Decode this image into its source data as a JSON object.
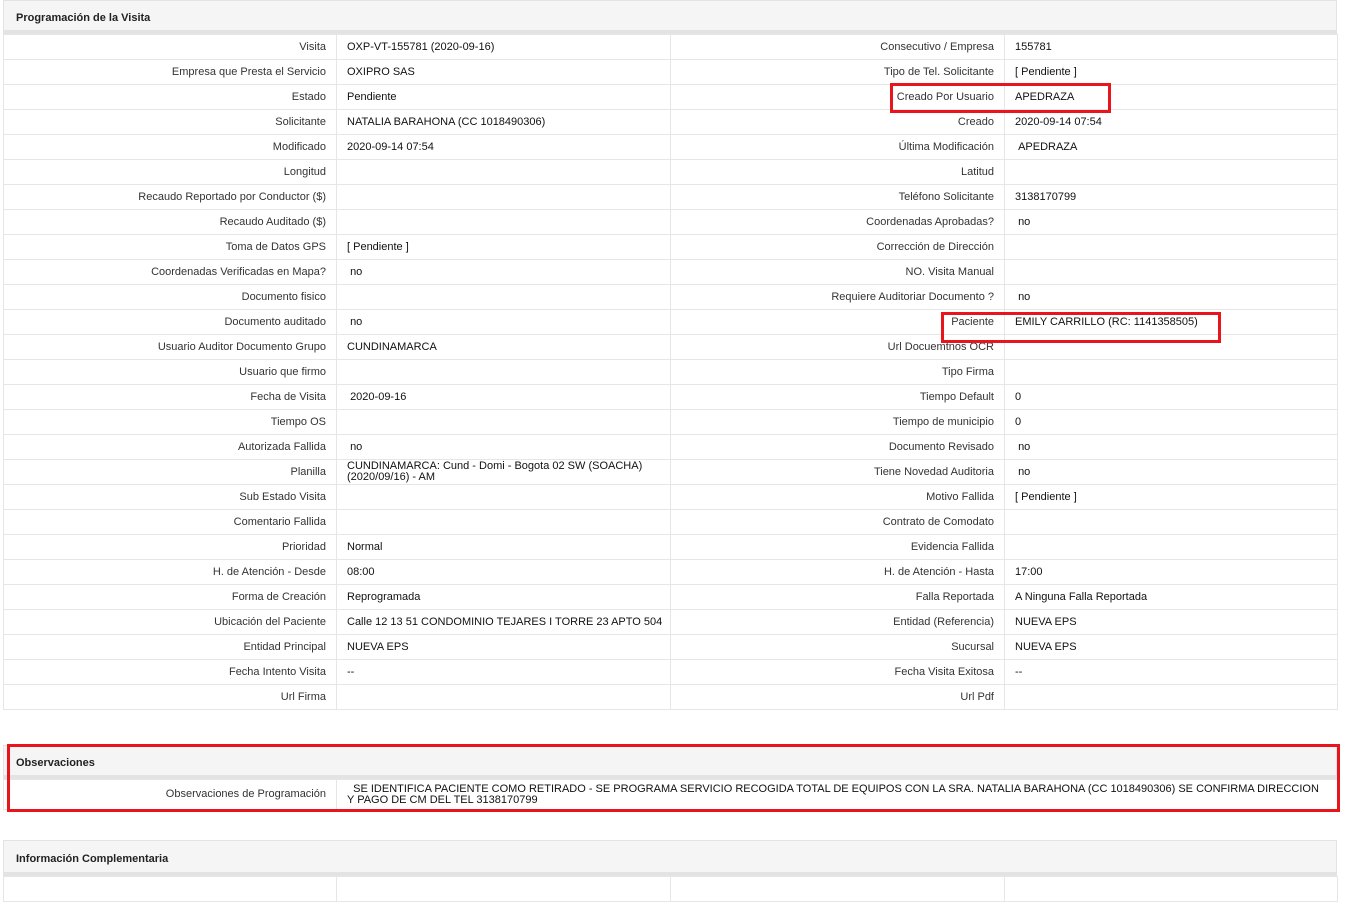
{
  "visit_panel": {
    "title": "Programación de la Visita",
    "rows": [
      {
        "l1": "Visita",
        "v1": "OXP-VT-155781 (2020-09-16)",
        "l2": "Consecutivo / Empresa",
        "v2": "155781"
      },
      {
        "l1": "Empresa que Presta el Servicio",
        "v1": "OXIPRO SAS",
        "l2": "Tipo de Tel. Solicitante",
        "v2": "[ Pendiente ]"
      },
      {
        "l1": "Estado",
        "v1": "Pendiente",
        "l2": "Creado Por Usuario",
        "v2": "APEDRAZA"
      },
      {
        "l1": "Solicitante",
        "v1": "NATALIA BARAHONA (CC 1018490306)",
        "l2": "Creado",
        "v2": "2020-09-14 07:54"
      },
      {
        "l1": "Modificado",
        "v1": "2020-09-14 07:54",
        "l2": "Última Modificación",
        "v2": " APEDRAZA"
      },
      {
        "l1": "Longitud",
        "v1": "",
        "l2": "Latitud",
        "v2": ""
      },
      {
        "l1": "Recaudo Reportado por Conductor ($)",
        "v1": "",
        "l2": "Teléfono Solicitante",
        "v2": "3138170799"
      },
      {
        "l1": "Recaudo Auditado ($)",
        "v1": "",
        "l2": "Coordenadas Aprobadas?",
        "v2": " no"
      },
      {
        "l1": "Toma de Datos GPS",
        "v1": "[ Pendiente ]",
        "l2": "Corrección de Dirección",
        "v2": ""
      },
      {
        "l1": "Coordenadas Verificadas en Mapa?",
        "v1": " no",
        "l2": "NO. Visita Manual",
        "v2": ""
      },
      {
        "l1": "Documento fisico",
        "v1": "",
        "l2": "Requiere Auditoriar Documento ?",
        "v2": " no"
      },
      {
        "l1": "Documento auditado",
        "v1": " no",
        "l2": "Paciente",
        "v2": "EMILY CARRILLO (RC: 1141358505)"
      },
      {
        "l1": "Usuario Auditor Documento Grupo",
        "v1": "CUNDINAMARCA",
        "l2": "Url Docuemtnos OCR",
        "v2": ""
      },
      {
        "l1": "Usuario que firmo",
        "v1": "",
        "l2": "Tipo Firma",
        "v2": ""
      },
      {
        "l1": "Fecha de Visita",
        "v1": " 2020-09-16",
        "l2": "Tiempo Default",
        "v2": "0"
      },
      {
        "l1": "Tiempo OS",
        "v1": "",
        "l2": "Tiempo de municipio",
        "v2": "0"
      },
      {
        "l1": "Autorizada Fallida",
        "v1": " no",
        "l2": "Documento Revisado",
        "v2": " no"
      },
      {
        "l1": "Planilla",
        "v1": "CUNDINAMARCA: Cund - Domi - Bogota 02 SW (SOACHA) (2020/09/16) - AM",
        "l2": "Tiene Novedad Auditoria",
        "v2": " no"
      },
      {
        "l1": "Sub Estado Visita",
        "v1": "",
        "l2": "Motivo Fallida",
        "v2": "[ Pendiente ]"
      },
      {
        "l1": "Comentario Fallida",
        "v1": "",
        "l2": "Contrato de Comodato",
        "v2": ""
      },
      {
        "l1": "Prioridad",
        "v1": "Normal",
        "l2": "Evidencia Fallida",
        "v2": ""
      },
      {
        "l1": "H. de Atención - Desde",
        "v1": "08:00",
        "l2": "H. de Atención - Hasta",
        "v2": "17:00"
      },
      {
        "l1": "Forma de Creación",
        "v1": "Reprogramada",
        "l2": "Falla Reportada",
        "v2": "A Ninguna Falla Reportada"
      },
      {
        "l1": "Ubicación del Paciente",
        "v1": "Calle 12 13 51 CONDOMINIO TEJARES I TORRE 23 APTO 504",
        "l2": "Entidad (Referencia)",
        "v2": "NUEVA EPS"
      },
      {
        "l1": "Entidad Principal",
        "v1": "NUEVA EPS",
        "l2": "Sucursal",
        "v2": "NUEVA EPS"
      },
      {
        "l1": "Fecha Intento Visita",
        "v1": "--",
        "l2": "Fecha Visita Exitosa",
        "v2": "--"
      },
      {
        "l1": "Url Firma",
        "v1": "",
        "l2": "Url Pdf",
        "v2": ""
      }
    ]
  },
  "observations_panel": {
    "title": "Observaciones",
    "label": "Observaciones de Programación",
    "value": "  SE IDENTIFICA PACIENTE COMO RETIRADO - SE PROGRAMA SERVICIO RECOGIDA TOTAL DE EQUIPOS CON LA SRA. NATALIA BARAHONA (CC 1018490306) SE CONFIRMA DIRECCION Y PAGO DE CM DEL TEL 3138170799"
  },
  "complementary_panel": {
    "title": "Información Complementaria"
  },
  "colors": {
    "highlight": "#e8151d",
    "header_bg": "#f5f5f5",
    "border": "#e6e6e6"
  }
}
